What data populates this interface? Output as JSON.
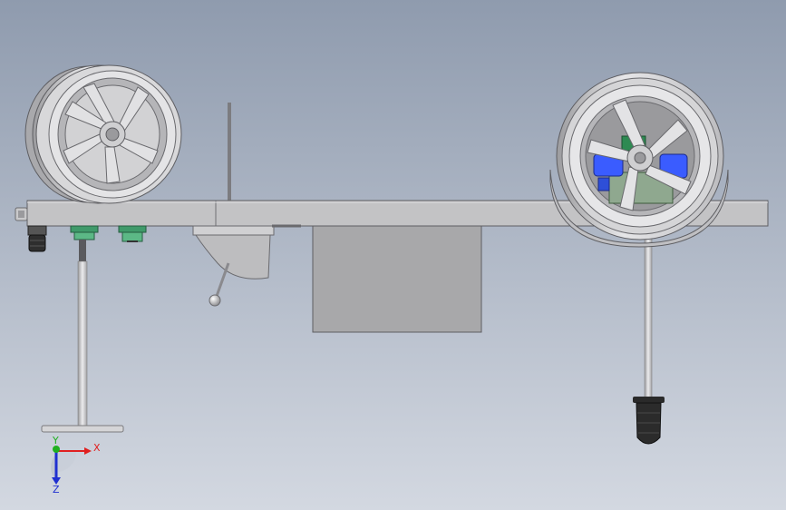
{
  "triad": {
    "x_label": "X",
    "y_label": "Y",
    "z_label": "Z",
    "x_color": "#e02020",
    "y_color": "#20b020",
    "z_color": "#2030d0"
  },
  "colors": {
    "background_top": "#8f9bae",
    "background_bottom": "#d3d8e1",
    "metal": "#c4c4c6",
    "metal_dark": "#8d8d90",
    "motor_blue": "#3a5cff",
    "fitting_green": "#3f9a6a",
    "bumper_black": "#2a2a2a"
  }
}
